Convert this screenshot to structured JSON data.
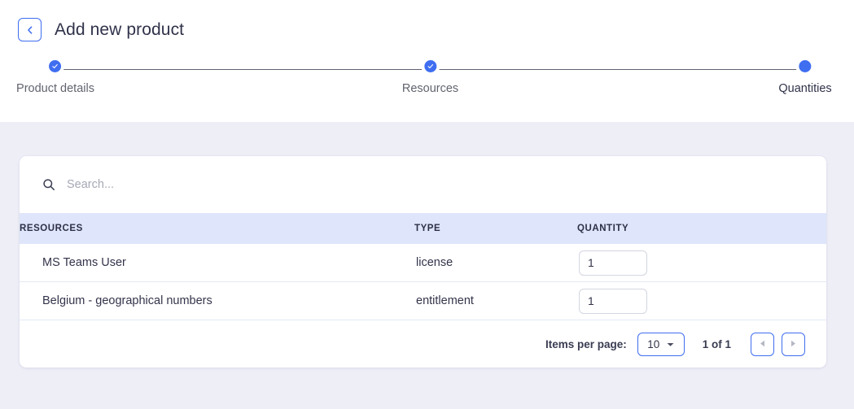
{
  "header": {
    "back_icon": "chevron-left-icon",
    "title": "Add new product"
  },
  "stepper": {
    "steps": [
      {
        "label": "Product details",
        "state": "completed",
        "icon": "check-icon"
      },
      {
        "label": "Resources",
        "state": "completed",
        "icon": "check-icon"
      },
      {
        "label": "Quantities",
        "state": "active",
        "icon": "dot-icon"
      }
    ]
  },
  "search": {
    "icon": "search-icon",
    "value": "",
    "placeholder": "Search..."
  },
  "table": {
    "columns": [
      {
        "key": "resource",
        "label": "RESOURCES"
      },
      {
        "key": "type",
        "label": "TYPE"
      },
      {
        "key": "quantity",
        "label": "QUANTITY"
      }
    ],
    "rows": [
      {
        "resource": "MS Teams User",
        "type": "license",
        "quantity": "1"
      },
      {
        "resource": "Belgium - geographical numbers",
        "type": "entitlement",
        "quantity": "1"
      }
    ]
  },
  "pagination": {
    "items_per_page_label": "Items per page:",
    "page_size": "10",
    "page_size_caret_icon": "chevron-down-icon",
    "range_label": "1 of 1",
    "prev_icon": "triangle-left-icon",
    "next_icon": "triangle-right-icon"
  },
  "colors": {
    "accent": "#3f6ef0",
    "page_background": "#eeeef7",
    "table_header_background": "#dfe6fb",
    "card_background": "#ffffff"
  }
}
